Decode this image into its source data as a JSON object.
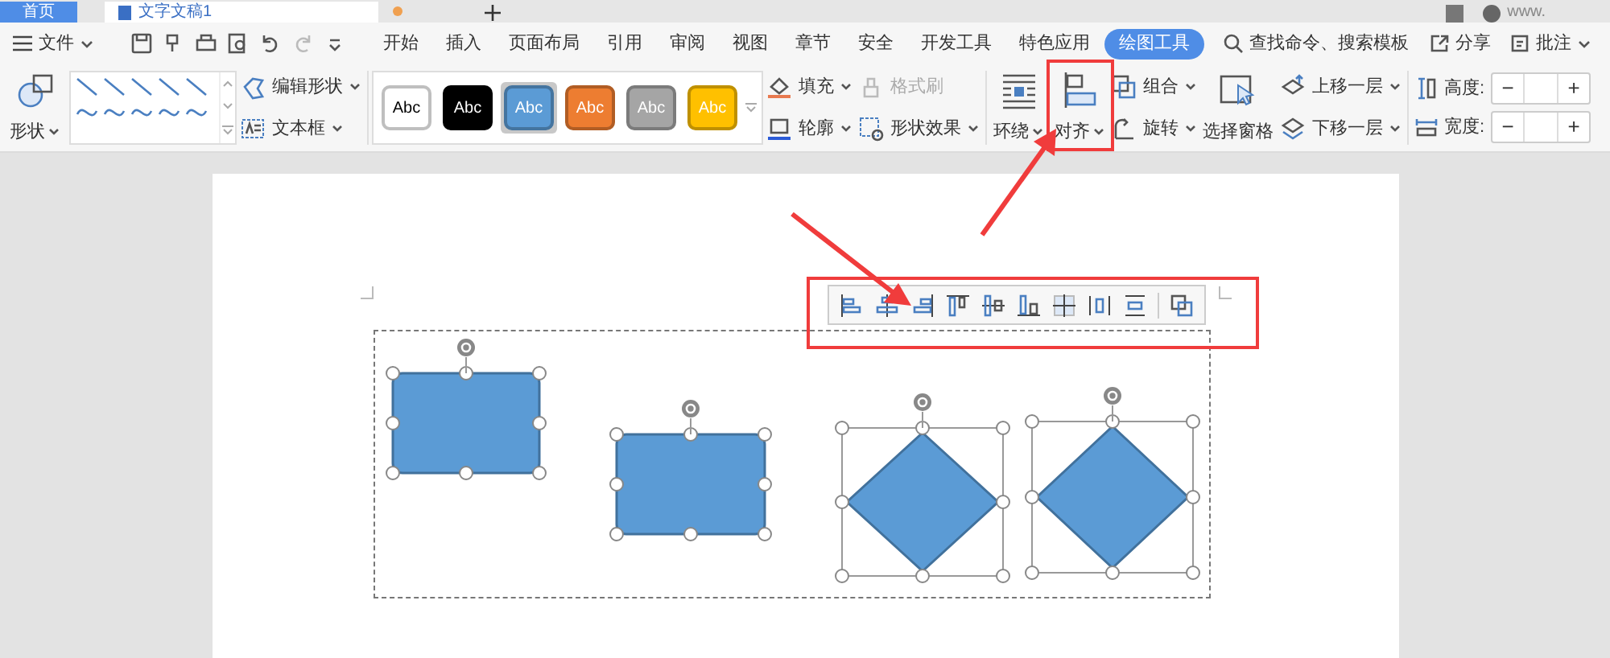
{
  "document_tabs": [
    {
      "label": "首页",
      "kind": "home"
    },
    {
      "label": "文字文稿1",
      "kind": "document"
    }
  ],
  "user": {
    "name": "www."
  },
  "menu": {
    "file": "文件",
    "ribbon_tabs": [
      {
        "label": "开始",
        "selected": false
      },
      {
        "label": "插入",
        "selected": false
      },
      {
        "label": "页面布局",
        "selected": false
      },
      {
        "label": "引用",
        "selected": false
      },
      {
        "label": "审阅",
        "selected": false
      },
      {
        "label": "视图",
        "selected": false
      },
      {
        "label": "章节",
        "selected": false
      },
      {
        "label": "安全",
        "selected": false
      },
      {
        "label": "开发工具",
        "selected": false
      },
      {
        "label": "特色应用",
        "selected": false
      },
      {
        "label": "绘图工具",
        "selected": true
      }
    ],
    "search": {
      "placeholder": "查找命令、搜索模板"
    },
    "share": "分享",
    "comment": "批注"
  },
  "ribbon": {
    "shape": "形状",
    "edit_shape": "编辑形状",
    "text_box": "文本框",
    "styles": [
      {
        "label": "Abc",
        "color": "#ffffff",
        "selected": false
      },
      {
        "label": "Abc",
        "color": "#000000",
        "selected": false
      },
      {
        "label": "Abc",
        "color": "#5b9bd5",
        "selected": true
      },
      {
        "label": "Abc",
        "color": "#ed7d31",
        "selected": false
      },
      {
        "label": "Abc",
        "color": "#a5a5a5",
        "selected": false
      },
      {
        "label": "Abc",
        "color": "#ffc000",
        "selected": false
      }
    ],
    "fill": "填充",
    "format_painter": {
      "label": "格式刷",
      "disabled": true
    },
    "outline": "轮廓",
    "shape_effect": "形状效果",
    "wrap": "环绕",
    "align": "对齐",
    "group": "组合",
    "rotate": "旋转",
    "selection_pane": "选择窗格",
    "bring_forward": "上移一层",
    "send_backward": "下移一层",
    "height_label": "高度:",
    "width_label": "宽度:",
    "minus": "−",
    "plus": "+"
  },
  "canvas": {
    "shapes": [
      {
        "kind": "rect"
      },
      {
        "kind": "rect"
      },
      {
        "kind": "diamond"
      },
      {
        "kind": "diamond"
      }
    ]
  }
}
